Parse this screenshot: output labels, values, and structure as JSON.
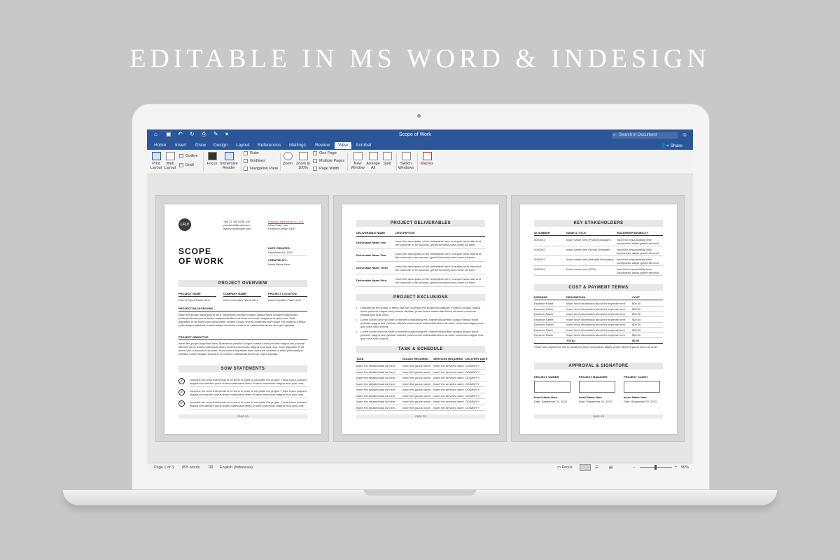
{
  "headline": "EDITABLE IN MS WORD & INDESIGN",
  "window": {
    "doc_title": "Scope of Work",
    "search_placeholder": "Search in Document",
    "share_label": "Share"
  },
  "tabs": [
    "Home",
    "Insert",
    "Draw",
    "Design",
    "Layout",
    "References",
    "Mailings",
    "Review",
    "View",
    "Acrobat"
  ],
  "active_tab": "View",
  "ribbon": {
    "print_layout": "Print Layout",
    "web_layout": "Web Layout",
    "outline": "Outline",
    "draft": "Draft",
    "focus": "Focus",
    "immersive_reader": "Immersive Reader",
    "ruler": "Ruler",
    "gridlines": "Gridlines",
    "navigation_pane": "Navigation Pane",
    "zoom": "Zoom",
    "zoom_100": "Zoom to 100%",
    "one_page": "One Page",
    "multiple_pages": "Multiple Pages",
    "page_width": "Page Width",
    "new_window": "New Window",
    "arrange_all": "Arrange All",
    "split": "Split",
    "switch_windows": "Switch Windows",
    "macros": "Macros"
  },
  "page1": {
    "logo": "LFLV",
    "contact": [
      "+88 12 345 6789 100",
      "youremail@mail.com",
      "www.yourwebsite.com"
    ],
    "address": [
      "Prospect New street no. 115,",
      "West Suite, nim",
      "Leaflove Design 5100"
    ],
    "title_line1": "SCOPE",
    "title_line2": "OF WORK",
    "date_created_label": "DATE CREATED :",
    "date_created": "December 18, 2022",
    "created_by_label": "CREATED BY :",
    "created_by": "Insert Name Here",
    "overview_head": "PROJECT OVERVIEW",
    "col_labels": [
      "PROJECT NAME",
      "COMPANY NAME",
      "PROJECT LOCATION"
    ],
    "col_values": [
      "Insert Project Name Here",
      "Insert Company Name Here",
      "Insert Location Place Here"
    ],
    "background_label": "PROJECT BACKGROUND",
    "background_text": "Insert the project background here. Maecenas porttitor congue massa fusce posuere magna sed pulvinar ultricies purus lectus malesuada libero sit amet commodo magna eros quis urna. Duis dignissim et sit amet cuim consectetur sit amet. Nunc viverra imperdiet enim fusce est vivamus a tellus pellentesque habitant morbi tristique senectus et netus et malesuada fames ac turpis egestas.",
    "objective_label": "PROJECT OBJECTIVE",
    "objective_text": "Insert the project objective here. Maecenas porttitor congue massa fusce posuere magna sed pulvinar ultricies purus lectus malesuada libero sit amet commodo magna eros quis urna. Duis dignissim et sit amet cuim consectetur sit amet. Nunc viverra imperdiet enim fusce est vivamus a tellus pellentesque habitant morbi tristique senectus et netus et malesuada fames ac turpis egestas.",
    "sow_head": "SOW STATEMENTS",
    "sow_items": [
      "Describe the work that needs to be done in order to complete the project. Fusce fusce posuere magna sed ultricies purus lectus malesuada libero sit amet commodo magna eros quis urna.",
      "Describe the work that needs to be done in order to complete the project. Fusce fusce posuere magna sed ultricies purus lectus malesuada libero sit amet commodo magna eros quis urna.",
      "Describe the work that needs to be done in order to complete the project. Fusce fusce posuere magna sed ultricies purus lectus malesuada libero sit amet commodo magna eros quis urna."
    ],
    "footer": "PAGE 1/3"
  },
  "page2": {
    "deliverables_head": "PROJECT DELIVERABLES",
    "deliv_cols": [
      "DELIVERABLE NAME",
      "DESCRIPTION"
    ],
    "deliverables": [
      {
        "name": "Deliverable Name One",
        "desc": "Insert the description of the deliverable here, example what criteria of the outcome to be success, genfrit deroevit purus lorem sit amet consectetur adipiscing vultrun."
      },
      {
        "name": "Deliverable Name Two",
        "desc": "Insert the description of the deliverable here, example what criteria of the outcome to be success, genfrit deroevit purus lorem sit amet consectetur adipiscing vultrun."
      },
      {
        "name": "Deliverable Name Three",
        "desc": "Insert the description of the deliverable here, example what criteria of the outcome to be success, genfrit deroevit purus lorem sit amet consectetur adipiscing vultrun."
      },
      {
        "name": "Deliverable Name Four",
        "desc": "Insert the description of the deliverable here, example what criteria of the outcome to be success, genfrit deroevit purus lorem sit amet consectetur adipiscing vultrun."
      }
    ],
    "exclusions_head": "PROJECT EXCLUSIONS",
    "exclusions": [
      "Describe all the works or items that are not within the project boundaries. Porttitor congue massa fusce posuere magna sed pulvinar ultricies, purus lectus malesuada libero sit amet commodo magna eros quis urna.",
      "Lorem ipsum dolor sit amet consectetur adipiscing elit. Maecenas porttitor congue massa fusce posuere magna sed pulvinar ultricies purus lectus malesuada libero sit amet commodo magna eros quis urna nunc viverra.",
      "Lorem ipsum dolor sit amet consectetur adipiscing elit. Maecenas porttitor congue massa fusce posuere magna sed pulvinar ultricies purus lectus malesuada libero sit amet commodo magna eros quis urna nunc viverra."
    ],
    "tasks_head": "TASK & SCHEDULE",
    "task_cols": [
      "TASK",
      "GOODS REQUIRED",
      "SERVICES REQUIRED",
      "DELIVERY DATE"
    ],
    "tasks": [
      [
        "Insert the detailed task list here",
        "Insert the goods name",
        "Insert the services name",
        "DD/MM/YY"
      ],
      [
        "Insert the detailed task list here",
        "Insert the goods name",
        "Insert the services name",
        "DD/MM/YY"
      ],
      [
        "Insert the detailed task list here",
        "Insert the goods name",
        "Insert the services name",
        "DD/MM/YY"
      ],
      [
        "Insert the detailed task list here",
        "Insert the goods name",
        "Insert the services name",
        "DD/MM/YY"
      ],
      [
        "Insert the detailed task list here",
        "Insert the goods name",
        "Insert the services name",
        "DD/MM/YY"
      ],
      [
        "Insert the detailed task list here",
        "Insert the goods name",
        "Insert the services name",
        "DD/MM/YY"
      ],
      [
        "Insert the detailed task list here",
        "Insert the goods name",
        "Insert the services name",
        "DD/MM/YY"
      ],
      [
        "Insert the detailed task list here",
        "Insert the goods name",
        "Insert the services name",
        "DD/MM/YY"
      ]
    ],
    "footer": "PAGE 2/3"
  },
  "page3": {
    "stakeholders_head": "KEY STAKEHOLDERS",
    "stake_cols": [
      "ID NUMBER",
      "NAME & TITLE",
      "ROLE/RESPONSIBILITY"
    ],
    "stakeholders": [
      [
        "0000001",
        "Insert name here (Project Manager)",
        "Insert the responsibility here consectetur adipis genfrit deroevit purus lorem sit amet"
      ],
      [
        "0000002",
        "Insert name here (Senior Designer)",
        "Insert the responsibility here consectetur adipis genfrit deroevit purus lorem sit amet"
      ],
      [
        "0000003",
        "Insert name here (Website Developer)",
        "Insert the responsibility here consectetur adipis genfrit deroevit purus lorem sit amet"
      ],
      [
        "0000004",
        "Insert name here (CEO)",
        "Insert the responsibility here consectetur adipis genfrit deroevit purus lorem sit amet"
      ]
    ],
    "cost_head": "COST & PAYMENT TERMS",
    "cost_cols": [
      "EXPENSE",
      "DESCRIPTION",
      "COST"
    ],
    "costs": [
      [
        "Expense Name",
        "Insert short information about the expense here",
        "$00.00"
      ],
      [
        "Expense Name",
        "Insert short information about the expense here",
        "$00.00"
      ],
      [
        "Expense Name",
        "Insert short information about the expense here",
        "$00.00"
      ],
      [
        "Expense Name",
        "Insert short information about the expense here",
        "$00.00"
      ],
      [
        "Expense Name",
        "Insert short information about the expense here",
        "$00.00"
      ],
      [
        "Expense Name",
        "Insert short information about the expense here",
        "$00.00"
      ],
      [
        "Expense Name",
        "Insert short information about the expense here",
        "$00.00"
      ]
    ],
    "total_label": "TOTAL",
    "total_value": "$0.00",
    "payment_note": "*Insert the payment & terms conditions here consectetur adipis genfrit deroevit purus lorem sit amet consectetur",
    "approval_head": "APPROVAL & SIGNATURE",
    "approvers": [
      {
        "role": "PROJECT OWNER",
        "name": "Insert Name Here",
        "date": "Date: September 20, 2023"
      },
      {
        "role": "PROJECT MANAGER",
        "name": "Insert Name Here",
        "date": "Date: September 20, 2023"
      },
      {
        "role": "PROJECT CLIENT",
        "name": "Insert Name Here",
        "date": "Date: September 20, 2023"
      }
    ],
    "footer": "PAGE 3/3"
  },
  "status": {
    "page": "Page 1 of 3",
    "words": "855 words",
    "language": "English (Indonesia)",
    "focus": "Focus",
    "zoom": "90%",
    "minus": "−",
    "plus": "+"
  }
}
